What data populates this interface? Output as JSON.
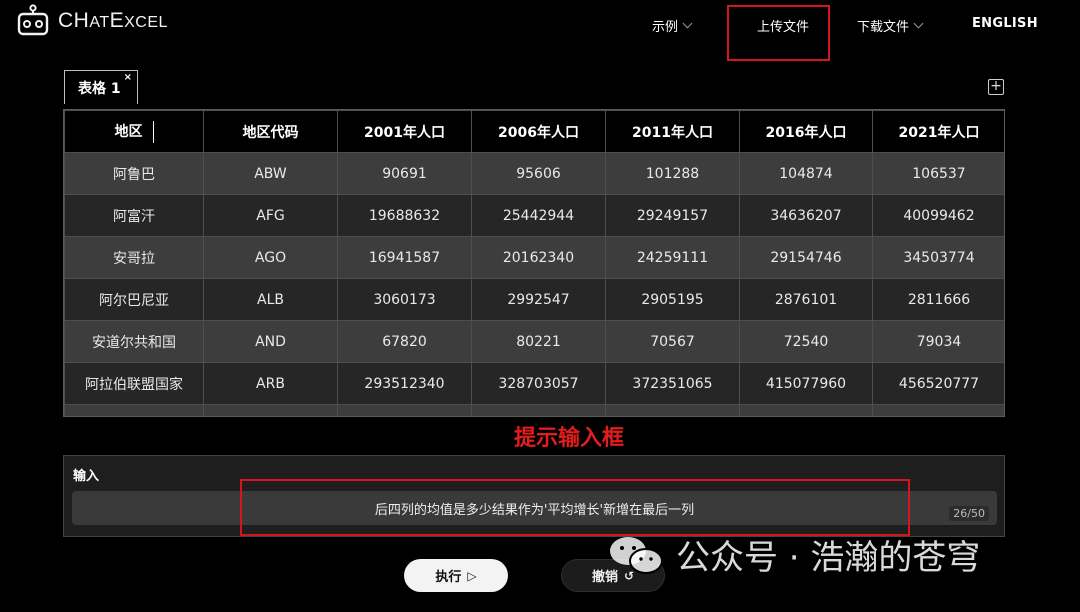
{
  "header": {
    "logo_text": "ChatExcel",
    "nav": [
      {
        "label": "示例",
        "has_dropdown": true
      },
      {
        "label": "上传文件",
        "has_dropdown": false
      },
      {
        "label": "下载文件",
        "has_dropdown": true
      },
      {
        "label": "ENGLISH",
        "has_dropdown": false
      }
    ]
  },
  "sheet_tabs": [
    {
      "label": "表格 1",
      "close": "×",
      "active": true
    }
  ],
  "add_sheet_label": "+",
  "table": {
    "columns": [
      "地区",
      "地区代码",
      "2001年人口",
      "2006年人口",
      "2011年人口",
      "2016年人口",
      "2021年人口"
    ],
    "rows": [
      [
        "阿鲁巴",
        "ABW",
        "90691",
        "95606",
        "101288",
        "104874",
        "106537"
      ],
      [
        "阿富汗",
        "AFG",
        "19688632",
        "25442944",
        "29249157",
        "34636207",
        "40099462"
      ],
      [
        "安哥拉",
        "AGO",
        "16941587",
        "20162340",
        "24259111",
        "29154746",
        "34503774"
      ],
      [
        "阿尔巴尼亚",
        "ALB",
        "3060173",
        "2992547",
        "2905195",
        "2876101",
        "2811666"
      ],
      [
        "安道尔共和国",
        "AND",
        "67820",
        "80221",
        "70567",
        "72540",
        "79034"
      ],
      [
        "阿拉伯联盟国家",
        "ARB",
        "293512340",
        "328703057",
        "372351065",
        "415077960",
        "456520777"
      ]
    ]
  },
  "annotation": "提示输入框",
  "input_panel": {
    "label": "输入",
    "value": "后四列的均值是多少结果作为'平均增长'新增在最后一列",
    "char_count": "26/50"
  },
  "buttons": {
    "run_label": "执行",
    "run_icon": "▷",
    "undo_label": "撤销",
    "undo_icon": "↺"
  },
  "watermark": {
    "text": "公众号 · 浩瀚的苍穹"
  },
  "colors": {
    "highlight": "#d4151b",
    "background": "#000000",
    "row_odd": "#3d3d3d",
    "row_even": "#262626"
  }
}
